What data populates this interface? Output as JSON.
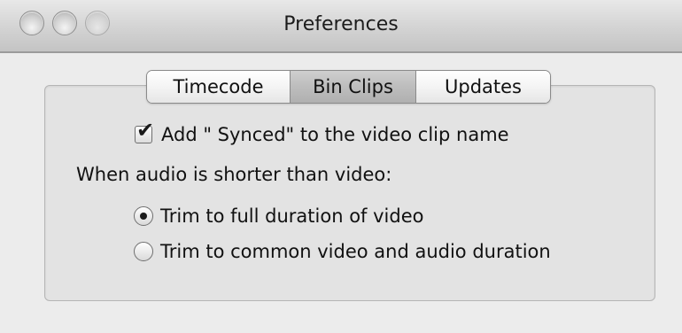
{
  "window": {
    "title": "Preferences"
  },
  "tabs": [
    {
      "label": "Timecode",
      "selected": false
    },
    {
      "label": "Bin Clips",
      "selected": true
    },
    {
      "label": "Updates",
      "selected": false
    }
  ],
  "options": {
    "add_synced_label": "Add \" Synced\" to the video clip name",
    "add_synced_checked": true,
    "audio_shorter_label": "When audio is shorter than video:",
    "radio_full_label": "Trim to full duration of video",
    "radio_full_selected": true,
    "radio_common_label": "Trim to common video and audio duration",
    "radio_common_selected": false
  },
  "icons": {
    "checkmark": "checkmark-icon",
    "close": "close-button",
    "minimize": "minimize-button",
    "zoom": "zoom-button"
  }
}
